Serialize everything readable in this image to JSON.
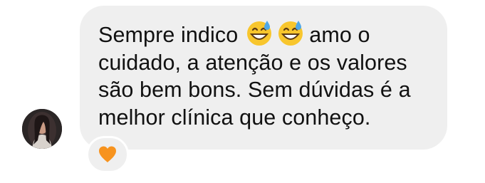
{
  "message": {
    "text_before_emoji": "Sempre indico",
    "text_after_emoji": "amo o cuidado, a atenção e os valores são bem bons. Sem dúvidas é a melhor clínica que conheço.",
    "emojis": [
      "grinning-face-with-sweat",
      "grinning-face-with-sweat"
    ]
  },
  "reaction": {
    "emoji": "orange-heart",
    "color": "#f7931e"
  },
  "colors": {
    "bubble_background": "#efefef",
    "text": "#111111"
  }
}
